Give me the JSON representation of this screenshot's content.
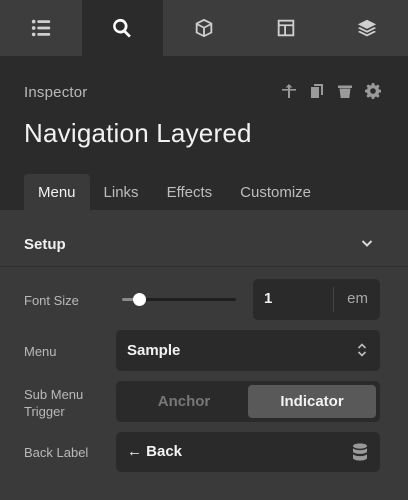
{
  "topbar": {
    "tabs": [
      {
        "icon": "list-icon",
        "active": false
      },
      {
        "icon": "search-icon",
        "active": true
      },
      {
        "icon": "cube-icon",
        "active": false
      },
      {
        "icon": "layout-icon",
        "active": false
      },
      {
        "icon": "layers-icon",
        "active": false
      }
    ]
  },
  "header": {
    "inspector_label": "Inspector",
    "title": "Navigation Layered",
    "actions": [
      "move-up-icon",
      "duplicate-icon",
      "trash-icon",
      "gear-icon"
    ]
  },
  "tabs": [
    {
      "label": "Menu",
      "active": true
    },
    {
      "label": "Links",
      "active": false
    },
    {
      "label": "Effects",
      "active": false
    },
    {
      "label": "Customize",
      "active": false
    }
  ],
  "section": {
    "title": "Setup",
    "expanded": true
  },
  "fields": {
    "font_size": {
      "label": "Font Size",
      "value": "1",
      "unit": "em",
      "slider_fraction": 0.15
    },
    "menu": {
      "label": "Menu",
      "value": "Sample"
    },
    "sub_menu_trigger": {
      "label_line1": "Sub Menu",
      "label_line2": "Trigger",
      "options": [
        "Anchor",
        "Indicator"
      ],
      "selected": "Indicator"
    },
    "back_label": {
      "label": "Back Label",
      "value": "← Back"
    }
  },
  "colors": {
    "panel_bg": "#3a3a3a",
    "header_bg": "#2b2b2b",
    "field_bg": "#2a2a2a",
    "toggle_active": "#595959"
  }
}
